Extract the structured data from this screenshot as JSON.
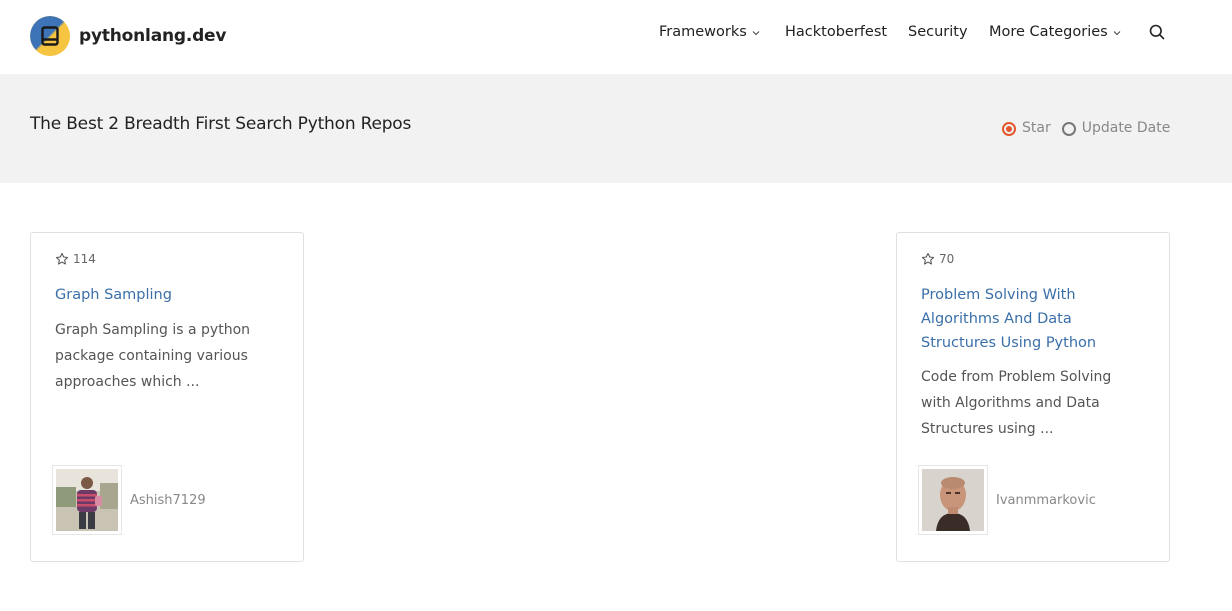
{
  "site": {
    "name": "pythonlang.dev"
  },
  "nav": {
    "items": [
      {
        "label": "Frameworks",
        "has_dropdown": true
      },
      {
        "label": "Hacktoberfest",
        "has_dropdown": false
      },
      {
        "label": "Security",
        "has_dropdown": false
      },
      {
        "label": "More Categories",
        "has_dropdown": true
      }
    ],
    "search_icon": "search-icon"
  },
  "banner": {
    "title": "The Best 2 Breadth First Search Python Repos",
    "sort": {
      "options": [
        "Star",
        "Update Date"
      ],
      "selected": "Star"
    }
  },
  "repos": [
    {
      "stars": "114",
      "title": "Graph Sampling",
      "description": "Graph Sampling is a python package containing various approaches which ...",
      "owner": "Ashish7129"
    },
    {
      "stars": "70",
      "title": "Problem Solving With Algorithms And Data Structures Using Python",
      "description": "Code from Problem Solving with Algorithms and Data Structures using ...",
      "owner": "Ivanmmarkovic"
    }
  ],
  "colors": {
    "accent": "#e4572e",
    "link": "#3a6fa8",
    "banner_bg": "#f2f2f2",
    "logo_blue": "#3d74b7",
    "logo_yellow": "#f5c542"
  }
}
